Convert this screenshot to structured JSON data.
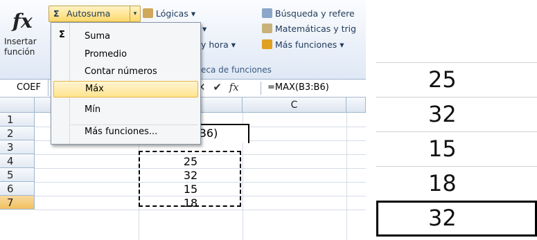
{
  "ribbon": {
    "insert_icon": "fx",
    "insert_label": "Insertar función",
    "autosum_label": "Autosuma",
    "logicas": "Lógicas ▾",
    "busqueda": "Búsqueda y refere",
    "matematicas": "Matemáticas y trig",
    "fecha": "y hora ▾",
    "mas_funciones": "Más funciones ▾",
    "group_label": "eca de funciones",
    "trunc_arrow": "▾"
  },
  "formula_bar": {
    "name_box": "COEF",
    "formula": "=MAX(B3:B6)",
    "icons": "✕ ✔ fx"
  },
  "autosum_menu": {
    "items": [
      "Suma",
      "Promedio",
      "Contar números",
      "Máx",
      "Mín",
      "Más funciones..."
    ],
    "highlighted": "Máx"
  },
  "sheet": {
    "col_c": "C",
    "rows": [
      "1",
      "2",
      "3",
      "4",
      "5",
      "6",
      "7"
    ],
    "values": [
      "25",
      "32",
      "15",
      "18"
    ],
    "editing_formula": "=MAX(B3:B6)"
  },
  "zoom": {
    "values": [
      "25",
      "32",
      "15",
      "18",
      "32"
    ]
  },
  "colors": {
    "accent": "#ffd86b",
    "selected_row": "#f1c15f"
  }
}
